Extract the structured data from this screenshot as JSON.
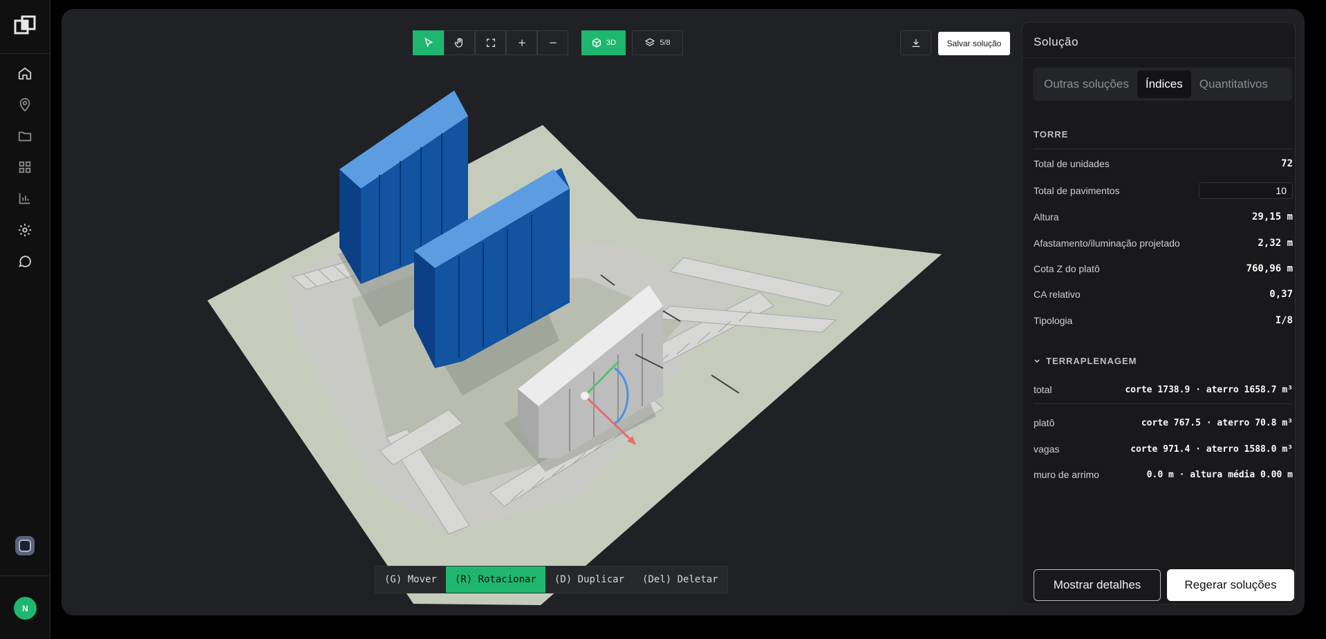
{
  "toolbar": {
    "view_3d_label": "3D",
    "layers_label": "5/8",
    "save_label": "Salvar solução"
  },
  "actions": {
    "move": "(G) Mover",
    "rotate": "(R) Rotacionar",
    "duplicate": "(D) Duplicar",
    "delete": "(Del) Deletar"
  },
  "user": {
    "avatar_initial": "N"
  },
  "panel": {
    "title": "Solução",
    "tabs": [
      "Outras soluções",
      "Índices",
      "Quantitativos"
    ],
    "active_tab": "Índices",
    "torre": {
      "heading": "TORRE",
      "total_unidades_label": "Total de unidades",
      "total_unidades": "72",
      "total_pavimentos_label": "Total de pavimentos",
      "total_pavimentos": "10",
      "altura_label": "Altura",
      "altura": "29,15 m",
      "afastamento_label": "Afastamento/iluminação projetado",
      "afastamento": "2,32 m",
      "cota_label": "Cota Z do platô",
      "cota": "760,96 m",
      "ca_label": "CA relativo",
      "ca": "0,37",
      "tipologia_label": "Tipologia",
      "tipologia": "I/8"
    },
    "terraplenagem": {
      "heading": "TERRAPLENAGEM",
      "total_label": "total",
      "total": "corte 1738.9 · aterro 1658.7 m³",
      "plato_label": "platô",
      "plato": "corte 767.5 · aterro 70.8 m³",
      "vagas_label": "vagas",
      "vagas": "corte 971.4 · aterro 1588.0 m³",
      "muro_label": "muro de arrimo",
      "muro": "0.0 m · altura média 0.00 m"
    },
    "buttons": {
      "details": "Mostrar detalhes",
      "regenerate": "Regerar soluções"
    }
  },
  "colors": {
    "accent": "#1fb770",
    "building_blue": "#1a5fb8",
    "building_selected": "#d9d9d9",
    "ground": "#c9cfbd"
  }
}
